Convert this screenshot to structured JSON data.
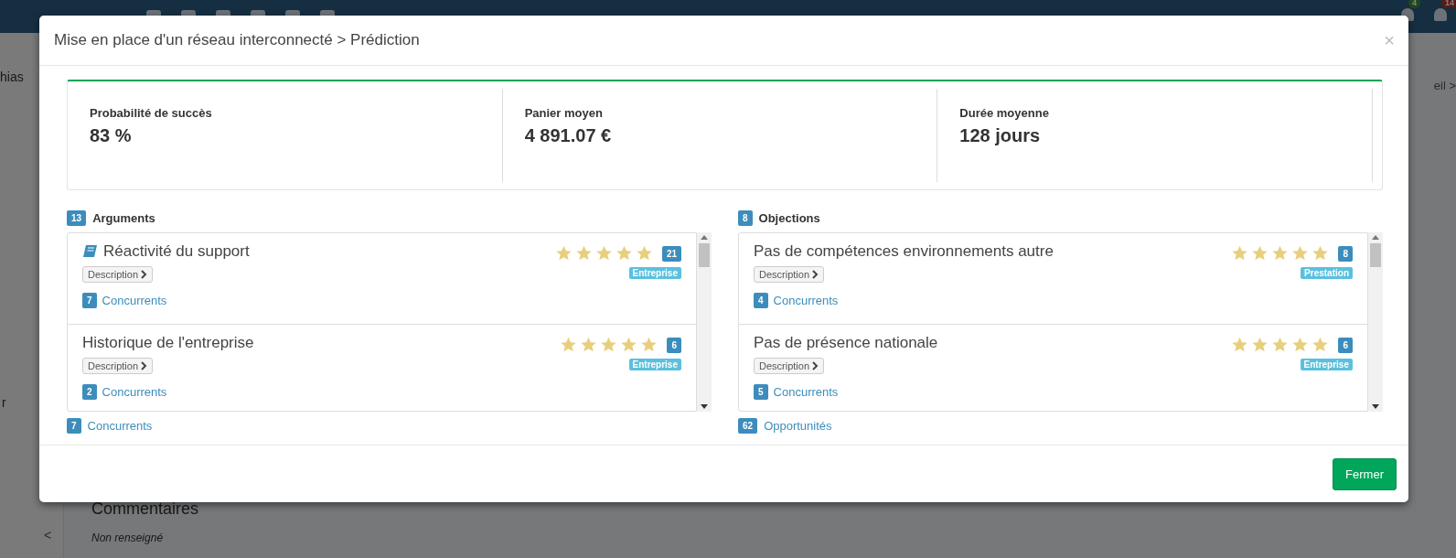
{
  "navbar": {
    "badges": [
      {
        "text": "4"
      },
      {
        "text": "14"
      }
    ]
  },
  "background": {
    "user_fragment": "hias",
    "breadcrumb_fragment": "eil >",
    "sidebar_fragment": "r",
    "collapse": "<",
    "section_title": "Commentaires",
    "section_value": "Non renseigné"
  },
  "modal": {
    "title": "Mise en place d'un réseau interconnecté > Prédiction",
    "close": "×",
    "metrics": [
      {
        "label": "Probabilité de succès",
        "value": "83 %"
      },
      {
        "label": "Panier moyen",
        "value": "4 891.07 €"
      },
      {
        "label": "Durée moyenne",
        "value": "128 jours"
      }
    ],
    "panels": [
      {
        "count": "13",
        "title": "Arguments",
        "items": [
          {
            "has_icon": true,
            "title": "Réactivité du support",
            "description": "Description",
            "stars": 5,
            "count": "21",
            "tag": "Entreprise",
            "competitors_count": "7",
            "competitors_label": "Concurrents"
          },
          {
            "has_icon": false,
            "title": "Historique de l'entreprise",
            "description": "Description",
            "stars": 5,
            "count": "6",
            "tag": "Entreprise",
            "competitors_count": "2",
            "competitors_label": "Concurrents"
          }
        ],
        "footer": {
          "count": "7",
          "label": "Concurrents"
        }
      },
      {
        "count": "8",
        "title": "Objections",
        "items": [
          {
            "has_icon": false,
            "title": "Pas de compétences environnements autre",
            "description": "Description",
            "stars": 5,
            "count": "8",
            "tag": "Prestation",
            "competitors_count": "4",
            "competitors_label": "Concurrents"
          },
          {
            "has_icon": false,
            "title": "Pas de présence nationale",
            "description": "Description",
            "stars": 5,
            "count": "6",
            "tag": "Entreprise",
            "competitors_count": "5",
            "competitors_label": "Concurrents"
          }
        ],
        "footer": {
          "count": "62",
          "label": "Opportunités"
        }
      }
    ],
    "button": "Fermer"
  }
}
